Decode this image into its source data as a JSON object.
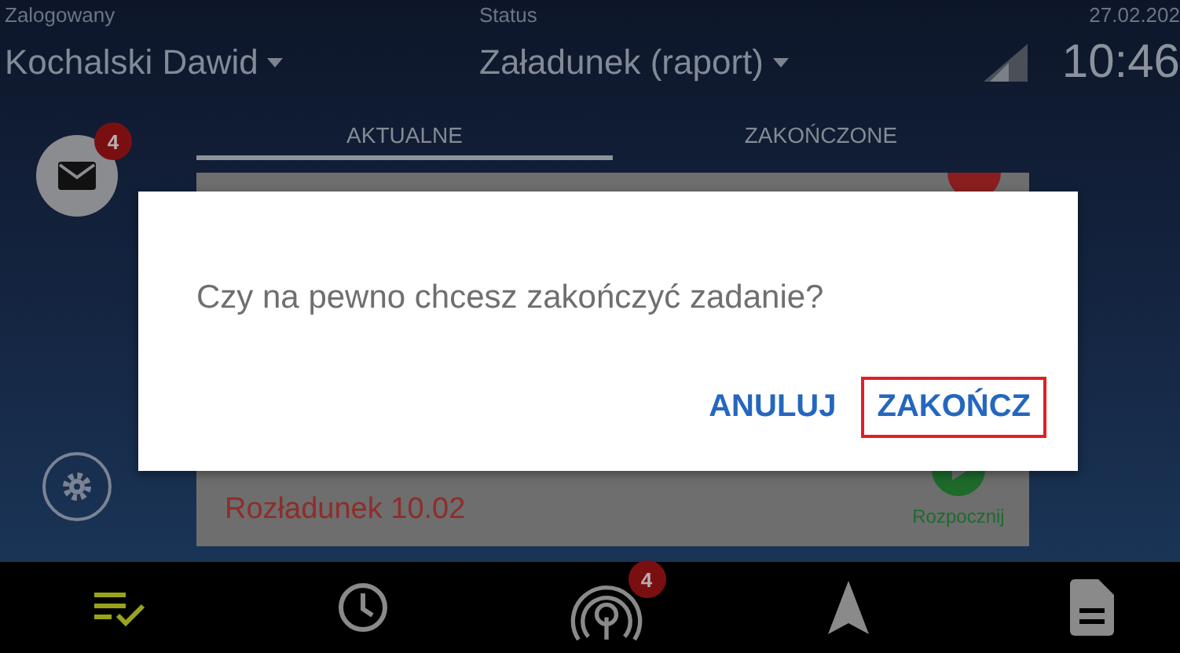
{
  "header": {
    "user": {
      "label": "Zalogowany",
      "value": "Kochalski Dawid"
    },
    "status": {
      "label": "Status",
      "value": "Załadunek (raport)"
    },
    "date": "27.02.202",
    "time": "10:46"
  },
  "tabs": [
    {
      "label": "AKTUALNE",
      "selected": true
    },
    {
      "label": "ZAKOŃCZONE",
      "selected": false
    }
  ],
  "mail_badge": "4",
  "card": {
    "status": "Rozładunek 10.02",
    "action": "Rozpocznij"
  },
  "dialog": {
    "message": "Czy na pewno chcesz zakończyć zadanie?",
    "buttons": [
      {
        "label": "ANULUJ",
        "highlighted": false
      },
      {
        "label": "ZAKOŃCZ",
        "highlighted": true
      }
    ]
  },
  "nav": [
    {
      "kind": "tasks",
      "selected": true
    },
    {
      "kind": "history",
      "selected": false
    },
    {
      "kind": "radio",
      "selected": false,
      "badge": "4"
    },
    {
      "kind": "navigation",
      "selected": false
    },
    {
      "kind": "document",
      "selected": false
    }
  ]
}
